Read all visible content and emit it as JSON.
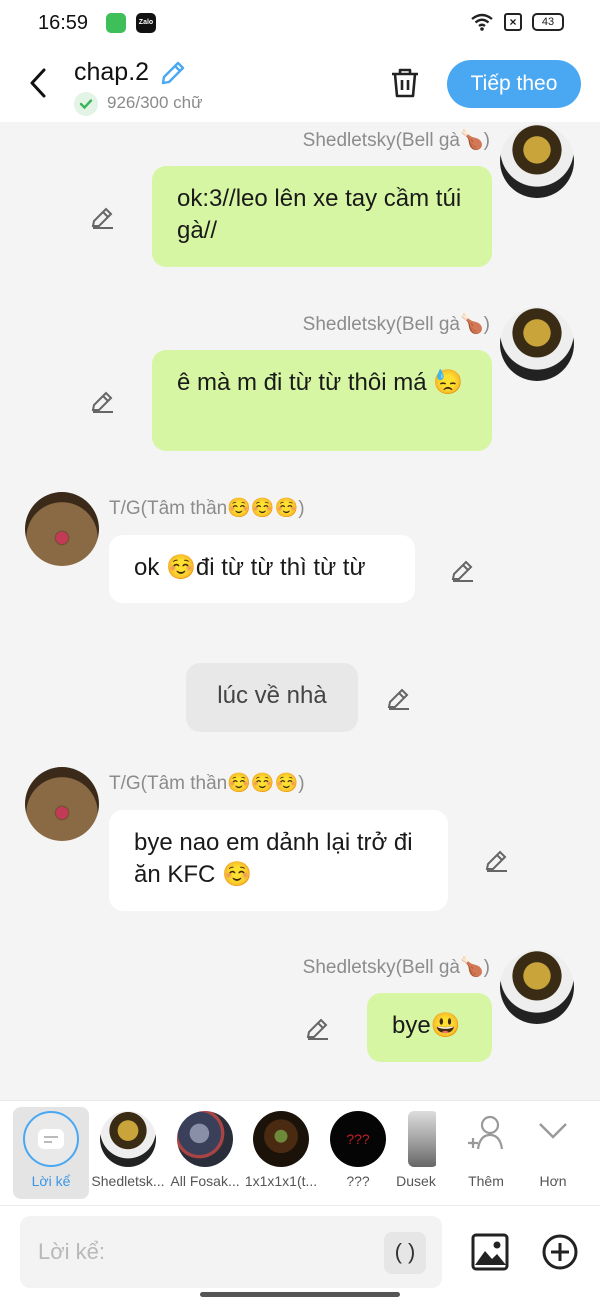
{
  "status": {
    "time": "16:59",
    "battery": "43",
    "app2": "Zalo"
  },
  "header": {
    "title": "chap.2",
    "word_count": "926/300 chữ",
    "next_label": "Tiếp theo"
  },
  "messages": [
    {
      "name": "Shedletsky(Bell gà🍗)",
      "text": "ok:3//leo lên xe tay cầm túi gà//"
    },
    {
      "name": "Shedletsky(Bell gà🍗)",
      "text": "ê mà m đi từ từ thôi má 😓"
    },
    {
      "name": "T/G(Tâm thần☺️☺️☺️)",
      "text": "ok ☺️đi từ từ thì từ từ"
    },
    {
      "name": "",
      "text": "lúc về nhà"
    },
    {
      "name": "T/G(Tâm thần☺️☺️☺️)",
      "text": "bye nao em dảnh lại trở đi ăn KFC ☺️"
    },
    {
      "name": "Shedletsky(Bell gà🍗)",
      "text": "bye😃"
    }
  ],
  "characters": [
    {
      "label": "Lời kể"
    },
    {
      "label": "Shedletsk..."
    },
    {
      "label": "All Fosak..."
    },
    {
      "label": "1x1x1x1(t..."
    },
    {
      "label": "???"
    },
    {
      "label": "Dusek"
    },
    {
      "label": "Thêm"
    },
    {
      "label": "Hơn"
    }
  ],
  "input": {
    "placeholder": "Lời kể:",
    "paren_label": "( )"
  }
}
